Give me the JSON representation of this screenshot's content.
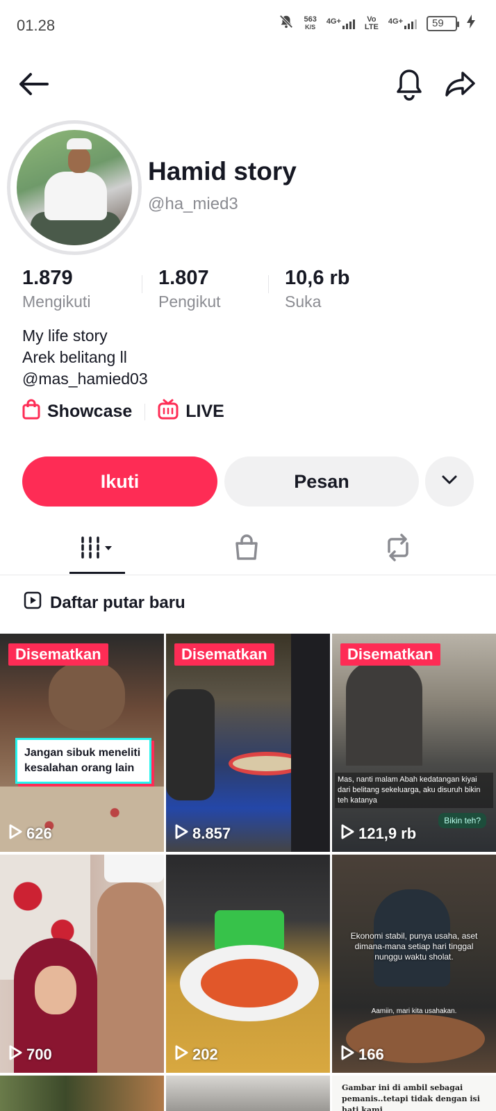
{
  "status_bar": {
    "time": "01.28",
    "net_speed": "563",
    "net_unit": "K/S",
    "sim1": "4G+",
    "volte_top": "Vo",
    "volte_bottom": "LTE",
    "sim2": "4G+",
    "battery": "59"
  },
  "profile": {
    "display_name": "Hamid story",
    "username": "@ha_mied3",
    "stats": [
      {
        "value": "1.879",
        "label": "Mengikuti"
      },
      {
        "value": "1.807",
        "label": "Pengikut"
      },
      {
        "value": "10,6 rb",
        "label": "Suka"
      }
    ],
    "bio": [
      "My life story",
      "Arek belitang ll",
      "@mas_hamied03"
    ],
    "links": {
      "showcase": "Showcase",
      "live": "LIVE"
    }
  },
  "actions": {
    "follow": "Ikuti",
    "message": "Pesan"
  },
  "playlist_label": "Daftar putar baru",
  "videos": [
    {
      "pinned": "Disematkan",
      "views": "626",
      "caption": "Jangan sibuk meneliti kesalahan orang lain"
    },
    {
      "pinned": "Disematkan",
      "views": "8.857"
    },
    {
      "pinned": "Disematkan",
      "views": "121,9 rb",
      "overlay_text": "Mas, nanti malam Abah kedatangan kiyai dari belitang sekeluarga, aku disuruh bikin teh katanya",
      "reply": "Bikin teh?"
    },
    {
      "views": "700"
    },
    {
      "views": "202"
    },
    {
      "views": "166",
      "overlay_text": "Ekonomi stabil, punya usaha, aset dimana-mana setiap hari tinggal nunggu waktu sholat.",
      "overlay_sub": "Aamiin, mari kita usahakan."
    },
    {
      "overlay_text": "Gambar ini di ambil sebagai pemanis..tetapi tidak dengan isi hati kami"
    }
  ],
  "colors": {
    "accent": "#fe2c55",
    "secondary_bg": "#f1f1f2",
    "muted_text": "#8a8b91"
  }
}
